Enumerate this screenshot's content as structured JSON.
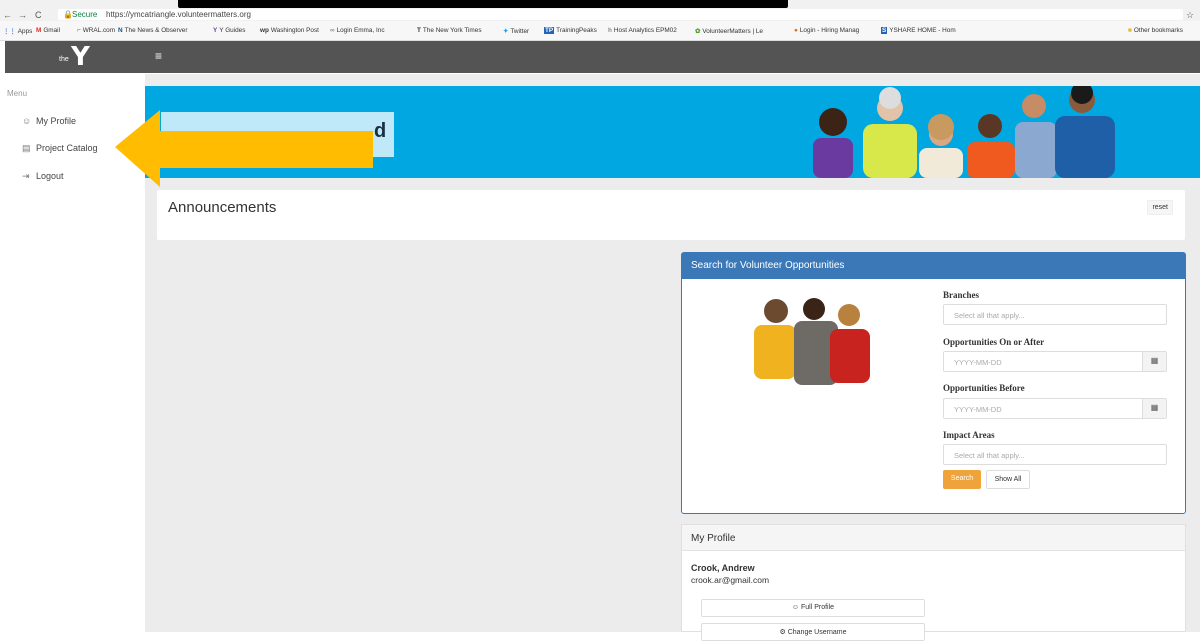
{
  "browser": {
    "url_secure": "Secure",
    "url": "https://ymcatriangle.volunteermatters.org",
    "nav_back": "←",
    "nav_forward": "→",
    "nav_reload": "C",
    "star": "☆",
    "bookmarks": [
      {
        "label": "Apps",
        "icon": "apps-icon"
      },
      {
        "label": "Gmail",
        "icon": "gmail-icon"
      },
      {
        "label": "WRAL.com",
        "icon": "wral-icon"
      },
      {
        "label": "The News & Observer",
        "icon": "news-observer-icon"
      },
      {
        "label": "Y Guides",
        "icon": "ymca-icon"
      },
      {
        "label": "Washington Post",
        "icon": "washington-post-icon"
      },
      {
        "label": "Login Emma, Inc",
        "icon": "emma-icon"
      },
      {
        "label": "The New York Times",
        "icon": "nyt-icon"
      },
      {
        "label": "Twitter",
        "icon": "twitter-icon"
      },
      {
        "label": "TrainingPeaks",
        "icon": "trainingpeaks-icon"
      },
      {
        "label": "Host Analytics EPM02",
        "icon": "host-analytics-icon"
      },
      {
        "label": "VolunteerMatters | Le",
        "icon": "volunteermatters-icon"
      },
      {
        "label": "Login - Hiring Manag",
        "icon": "hiring-icon"
      },
      {
        "label": "YSHARE HOME - Hom",
        "icon": "yshare-icon"
      }
    ],
    "other_bookmarks": "Other bookmarks"
  },
  "header": {
    "logo_text": "the",
    "logo_letter": "Y",
    "menu_icon": "≡"
  },
  "sidebar": {
    "title": "Menu",
    "items": [
      {
        "label": "My Profile",
        "icon": "☺"
      },
      {
        "label": "Project Catalog",
        "icon": "▤"
      },
      {
        "label": "Logout",
        "icon": "⇥"
      }
    ]
  },
  "hero": {
    "visible_text": "d"
  },
  "announcements": {
    "title": "Announcements",
    "reset": "reset"
  },
  "search": {
    "title": "Search for Volunteer Opportunities",
    "branches_label": "Branches",
    "branches_placeholder": "Select all that apply...",
    "on_after_label": "Opportunities On or After",
    "on_after_placeholder": "YYYY-MM-DD",
    "before_label": "Opportunities Before",
    "before_placeholder": "YYYY-MM-DD",
    "impact_label": "Impact Areas",
    "impact_placeholder": "Select all that apply...",
    "search_button": "Search",
    "show_all_button": "Show All",
    "calendar_icon": "▦"
  },
  "profile": {
    "title": "My Profile",
    "name": "Crook, Andrew",
    "email": "crook.ar@gmail.com",
    "full_profile": "☺ Full Profile",
    "change_username": "⚙ Change Username"
  },
  "colors": {
    "header_gray": "#545454",
    "hero_blue": "#00a7e1",
    "panel_blue": "#3a78b8",
    "search_orange": "#f0a33a",
    "arrow_yellow": "#ffbc00"
  }
}
